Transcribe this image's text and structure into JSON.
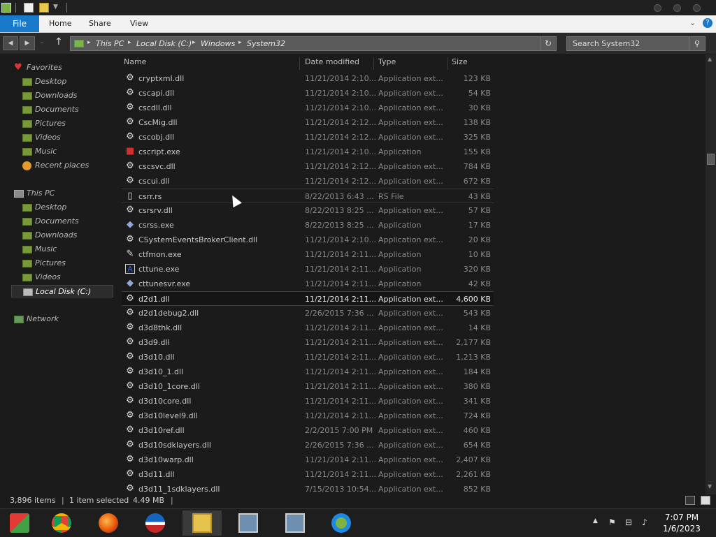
{
  "ribbon": {
    "file": "File",
    "tabs": [
      "Home",
      "Share",
      "View"
    ],
    "help": "?"
  },
  "address": {
    "crumbs": [
      "This PC",
      "Local Disk (C:)",
      "Windows",
      "System32"
    ]
  },
  "search": {
    "placeholder": "Search System32"
  },
  "nav": {
    "favorites": "Favorites",
    "fav_items": [
      "Desktop",
      "Downloads",
      "Documents",
      "Pictures",
      "Videos",
      "Music",
      "Recent places"
    ],
    "thispc": "This PC",
    "pc_items": [
      "Desktop",
      "Documents",
      "Downloads",
      "Music",
      "Pictures",
      "Videos",
      "Local Disk (C:)"
    ],
    "network": "Network"
  },
  "columns": {
    "name": "Name",
    "date": "Date modified",
    "type": "Type",
    "size": "Size"
  },
  "files": [
    {
      "name": "cryptxml.dll",
      "date": "11/21/2014 2:10...",
      "type": "Application ext...",
      "size": "123 KB",
      "icon": "gear-icon"
    },
    {
      "name": "cscapi.dll",
      "date": "11/21/2014 2:10...",
      "type": "Application ext...",
      "size": "54 KB",
      "icon": "gear-icon"
    },
    {
      "name": "cscdll.dll",
      "date": "11/21/2014 2:10...",
      "type": "Application ext...",
      "size": "30 KB",
      "icon": "gear-icon"
    },
    {
      "name": "CscMig.dll",
      "date": "11/21/2014 2:12...",
      "type": "Application ext...",
      "size": "138 KB",
      "icon": "gear-icon"
    },
    {
      "name": "cscobj.dll",
      "date": "11/21/2014 2:12...",
      "type": "Application ext...",
      "size": "325 KB",
      "icon": "gear-icon"
    },
    {
      "name": "cscript.exe",
      "date": "11/21/2014 2:10...",
      "type": "Application",
      "size": "155 KB",
      "icon": "script-icon"
    },
    {
      "name": "cscsvc.dll",
      "date": "11/21/2014 2:12...",
      "type": "Application ext...",
      "size": "784 KB",
      "icon": "gear-icon"
    },
    {
      "name": "cscui.dll",
      "date": "11/21/2014 2:12...",
      "type": "Application ext...",
      "size": "672 KB",
      "icon": "gear-icon"
    },
    {
      "name": "csrr.rs",
      "date": "8/22/2013 6:43 ...",
      "type": "RS File",
      "size": "43 KB",
      "icon": "document-icon"
    },
    {
      "name": "csrsrv.dll",
      "date": "8/22/2013 8:25 ...",
      "type": "Application ext...",
      "size": "57 KB",
      "icon": "gear-icon"
    },
    {
      "name": "csrss.exe",
      "date": "8/22/2013 8:25 ...",
      "type": "Application",
      "size": "17 KB",
      "icon": "app-diamond-icon"
    },
    {
      "name": "CSystemEventsBrokerClient.dll",
      "date": "11/21/2014 2:10...",
      "type": "Application ext...",
      "size": "20 KB",
      "icon": "gear-icon"
    },
    {
      "name": "ctfmon.exe",
      "date": "11/21/2014 2:11...",
      "type": "Application",
      "size": "10 KB",
      "icon": "pen-icon"
    },
    {
      "name": "cttune.exe",
      "date": "11/21/2014 2:11...",
      "type": "Application",
      "size": "320 KB",
      "icon": "cleartype-icon"
    },
    {
      "name": "cttunesvr.exe",
      "date": "11/21/2014 2:11...",
      "type": "Application",
      "size": "42 KB",
      "icon": "app-diamond-icon"
    },
    {
      "name": "d2d1.dll",
      "date": "11/21/2014 2:11...",
      "type": "Application ext...",
      "size": "4,600 KB",
      "icon": "gear-icon"
    },
    {
      "name": "d2d1debug2.dll",
      "date": "2/26/2015 7:36 ...",
      "type": "Application ext...",
      "size": "543 KB",
      "icon": "gear-icon"
    },
    {
      "name": "d3d8thk.dll",
      "date": "11/21/2014 2:11...",
      "type": "Application ext...",
      "size": "14 KB",
      "icon": "gear-icon"
    },
    {
      "name": "d3d9.dll",
      "date": "11/21/2014 2:11...",
      "type": "Application ext...",
      "size": "2,177 KB",
      "icon": "gear-icon"
    },
    {
      "name": "d3d10.dll",
      "date": "11/21/2014 2:11...",
      "type": "Application ext...",
      "size": "1,213 KB",
      "icon": "gear-icon"
    },
    {
      "name": "d3d10_1.dll",
      "date": "11/21/2014 2:11...",
      "type": "Application ext...",
      "size": "184 KB",
      "icon": "gear-icon"
    },
    {
      "name": "d3d10_1core.dll",
      "date": "11/21/2014 2:11...",
      "type": "Application ext...",
      "size": "380 KB",
      "icon": "gear-icon"
    },
    {
      "name": "d3d10core.dll",
      "date": "11/21/2014 2:11...",
      "type": "Application ext...",
      "size": "341 KB",
      "icon": "gear-icon"
    },
    {
      "name": "d3d10level9.dll",
      "date": "11/21/2014 2:11...",
      "type": "Application ext...",
      "size": "724 KB",
      "icon": "gear-icon"
    },
    {
      "name": "d3d10ref.dll",
      "date": "2/2/2015 7:00 PM",
      "type": "Application ext...",
      "size": "460 KB",
      "icon": "gear-icon"
    },
    {
      "name": "d3d10sdklayers.dll",
      "date": "2/26/2015 7:36 ...",
      "type": "Application ext...",
      "size": "654 KB",
      "icon": "gear-icon"
    },
    {
      "name": "d3d10warp.dll",
      "date": "11/21/2014 2:11...",
      "type": "Application ext...",
      "size": "2,407 KB",
      "icon": "gear-icon"
    },
    {
      "name": "d3d11.dll",
      "date": "11/21/2014 2:11...",
      "type": "Application ext...",
      "size": "2,261 KB",
      "icon": "gear-icon"
    },
    {
      "name": "d3d11_1sdklayers.dll",
      "date": "7/15/2013 10:54...",
      "type": "Application ext...",
      "size": "852 KB",
      "icon": "gear-icon"
    }
  ],
  "selected_index": 15,
  "hover_index": 8,
  "status": {
    "count": "3,896 items",
    "selected": "1 item selected",
    "size": "4.49 MB"
  },
  "taskbar": {
    "apps": [
      "start-icon",
      "chrome-icon",
      "firefox-icon",
      "obama-logo-icon",
      "file-explorer-icon",
      "network-tool-icon",
      "network-tool2-icon",
      "users-icon"
    ],
    "active": "file-explorer-icon"
  },
  "clock": {
    "time": "7:07 PM",
    "date": "1/6/2023"
  },
  "colors": {
    "accent": "#1979ca",
    "background": "#1b1b1b"
  }
}
